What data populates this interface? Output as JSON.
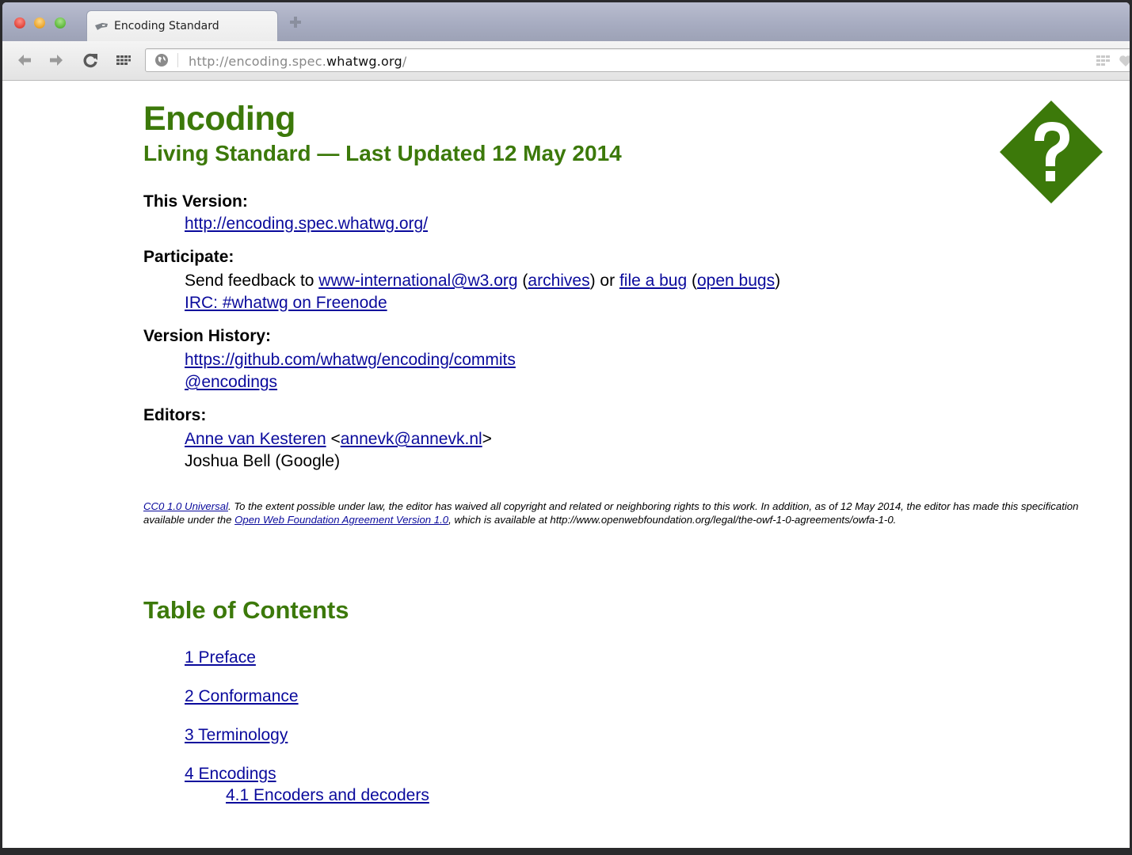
{
  "browser": {
    "tab": {
      "title": "Encoding Standard",
      "favicon": "whatwg-favicon"
    },
    "new_tab_icon": "plus-icon",
    "toolbar": {
      "back_icon": "arrow-left-icon",
      "forward_icon": "arrow-right-icon",
      "reload_icon": "reload-icon",
      "apps_icon": "apps-grid-icon"
    },
    "omnibox": {
      "scheme": "http://",
      "subdomain": "encoding.spec.",
      "host": "whatwg.org",
      "path": "/",
      "site_icon": "globe-icon"
    }
  },
  "document": {
    "title": "Encoding",
    "subtitle": "Living Standard — Last Updated 12 May 2014",
    "logo_icon": "question-diamond-icon",
    "logo_color": "#3c790a",
    "heading_color": "#3c790a",
    "link_color": "#0a0a9c",
    "meta": {
      "this_version_label": "This Version:",
      "this_version_link": "http://encoding.spec.whatwg.org/",
      "participate_label": "Participate:",
      "participate_text_1": "Send feedback to ",
      "participate_email": "www-international@w3.org",
      "participate_text_2": " (",
      "participate_archives": "archives",
      "participate_text_3": ") or ",
      "participate_file_bug": "file a bug",
      "participate_text_4": " (",
      "participate_open_bugs": "open bugs",
      "participate_text_5": ")",
      "participate_irc": "IRC: #whatwg on Freenode",
      "version_history_label": "Version History:",
      "version_history_commits": "https://github.com/whatwg/encoding/commits",
      "version_history_twitter": "@encodings",
      "editors_label": "Editors:",
      "editor_1_name": "Anne van Kesteren",
      "editor_1_lt": " <",
      "editor_1_email": "annevk@annevk.nl",
      "editor_1_gt": ">",
      "editor_2": "Joshua Bell (Google)"
    },
    "copyright": {
      "license_link": "CC0 1.0 Universal",
      "text_1": ". To the extent possible under law, the editor has waived all copyright and related or neighboring rights to this work. In addition, as of 12 May 2014, the editor has made this specification available under the ",
      "owf_link": "Open Web Foundation Agreement Version 1.0",
      "text_2": ", which is available at http://www.openwebfoundation.org/legal/the-owf-1-0-agreements/owfa-1-0."
    },
    "toc": {
      "heading": "Table of Contents",
      "items": [
        {
          "label": "1 Preface"
        },
        {
          "label": "2 Conformance"
        },
        {
          "label": "3 Terminology"
        },
        {
          "label": "4 Encodings",
          "children": [
            {
              "label": "4.1 Encoders and decoders"
            }
          ]
        }
      ]
    }
  }
}
